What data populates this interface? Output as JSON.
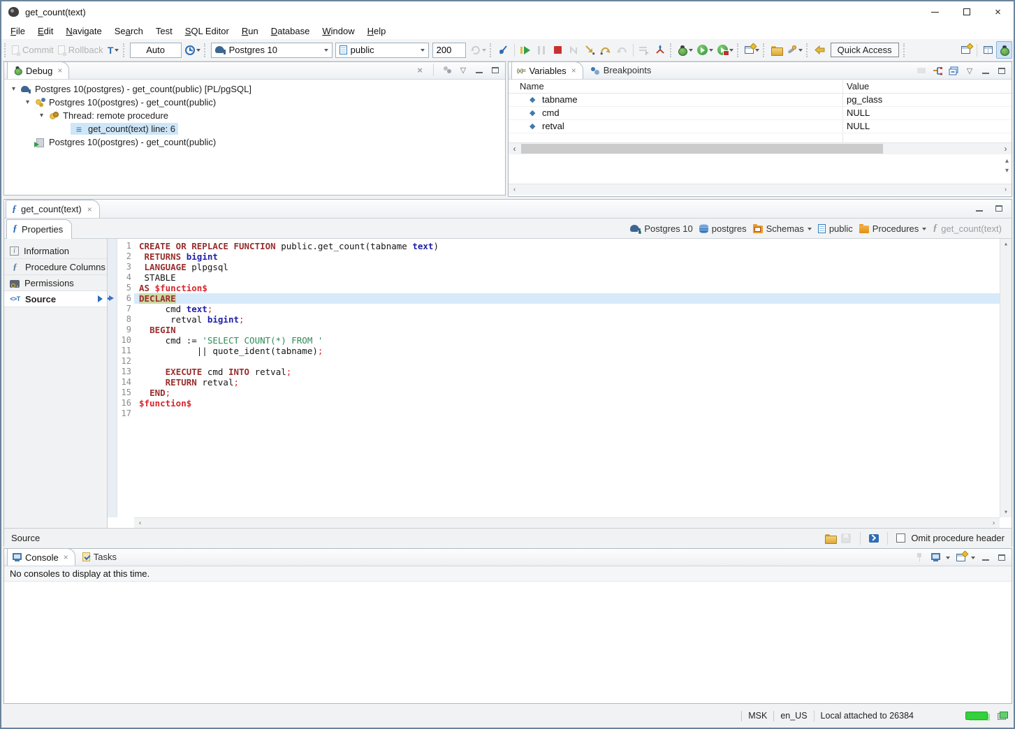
{
  "window": {
    "title": "get_count(text)"
  },
  "icons": {
    "close": "×",
    "caret_down": "▾",
    "view_menu": "▽",
    "scroll_up": "▴",
    "scroll_down": "▾",
    "scroll_left": "‹",
    "scroll_right": "›",
    "diamond": "◆",
    "frame": "≡",
    "function": "ƒ",
    "info": "i",
    "variables_tab": "(x)=",
    "transaction": "T",
    "source_tab": "<>T"
  },
  "colors": {
    "kw": "#992e2e",
    "ty": "#1f1fa8",
    "st": "#2e8b57",
    "dl": "#d8262c",
    "selbg": "#d7eafa",
    "curword": "#ccd9a4",
    "accent": "#2d6db5",
    "green": "#35d03c"
  },
  "menu": {
    "items": [
      {
        "label": "File",
        "mnemonic": "F"
      },
      {
        "label": "Edit",
        "mnemonic": "E"
      },
      {
        "label": "Navigate",
        "mnemonic": "N"
      },
      {
        "label": "Search",
        "mnemonic": "a"
      },
      {
        "label": "Test",
        "mnemonic": ""
      },
      {
        "label": "SQL Editor",
        "mnemonic": "S"
      },
      {
        "label": "Run",
        "mnemonic": "R"
      },
      {
        "label": "Database",
        "mnemonic": "D"
      },
      {
        "label": "Window",
        "mnemonic": "W"
      },
      {
        "label": "Help",
        "mnemonic": "H"
      }
    ]
  },
  "toolbar": {
    "commit": "Commit",
    "rollback": "Rollback",
    "auto": "Auto",
    "connection": "Postgres 10",
    "schema": "public",
    "fetch_size": "200",
    "quick_access": "Quick Access"
  },
  "debug_panel": {
    "tab_label": "Debug",
    "tree": [
      {
        "indent": 0,
        "caret": true,
        "icon": "postgres-session",
        "label": "Postgres 10(postgres) - get_count(public) [PL/pgSQL]",
        "selected": false
      },
      {
        "indent": 1,
        "caret": true,
        "icon": "process",
        "label": "Postgres 10(postgres) - get_count(public)",
        "selected": false
      },
      {
        "indent": 2,
        "caret": true,
        "icon": "thread",
        "label": "Thread: remote procedure",
        "selected": false
      },
      {
        "indent": 3,
        "caret": false,
        "icon": "stack-frame",
        "label": "get_count(text) line: 6",
        "selected": true
      },
      {
        "indent": 1,
        "caret": false,
        "icon": "process-terminated",
        "label": "Postgres 10(postgres) - get_count(public)",
        "selected": false
      }
    ]
  },
  "variables_panel": {
    "tabs": [
      "Variables",
      "Breakpoints"
    ],
    "columns": [
      "Name",
      "Value"
    ],
    "rows": [
      {
        "name": "tabname",
        "value": "pg_class"
      },
      {
        "name": "cmd",
        "value": "NULL"
      },
      {
        "name": "retval",
        "value": "NULL"
      }
    ]
  },
  "editor": {
    "tab_label": "get_count(text)",
    "properties_tab": "Properties",
    "breadcrumb": [
      {
        "label": "Postgres 10",
        "icon": "conn",
        "caret": false,
        "dim": false
      },
      {
        "label": "postgres",
        "icon": "database",
        "caret": false,
        "dim": false
      },
      {
        "label": "Schemas",
        "icon": "schemas",
        "caret": true,
        "dim": false
      },
      {
        "label": "public",
        "icon": "schema",
        "caret": false,
        "dim": false
      },
      {
        "label": "Procedures",
        "icon": "procfolder",
        "caret": true,
        "dim": false
      },
      {
        "label": "get_count(text)",
        "icon": "function",
        "caret": false,
        "dim": true
      }
    ],
    "sidebar": [
      {
        "label": "Information",
        "icon": "info",
        "selected": false
      },
      {
        "label": "Procedure Columns",
        "icon": "func",
        "selected": false
      },
      {
        "label": "Permissions",
        "icon": "perm",
        "selected": false
      },
      {
        "label": "Source",
        "icon": "source",
        "selected": true
      }
    ],
    "code": {
      "lines": [
        {
          "n": 1,
          "current": false,
          "segs": [
            [
              "kw",
              "CREATE OR REPLACE FUNCTION"
            ],
            [
              "pl",
              " public.get_count(tabname "
            ],
            [
              "ty",
              "text"
            ],
            [
              "pl",
              ")"
            ]
          ]
        },
        {
          "n": 2,
          "current": false,
          "segs": [
            [
              "pl",
              " "
            ],
            [
              "kw",
              "RETURNS"
            ],
            [
              "pl",
              " "
            ],
            [
              "ty",
              "bigint"
            ]
          ]
        },
        {
          "n": 3,
          "current": false,
          "segs": [
            [
              "pl",
              " "
            ],
            [
              "kw",
              "LANGUAGE"
            ],
            [
              "pl",
              " plpgsql"
            ]
          ]
        },
        {
          "n": 4,
          "current": false,
          "segs": [
            [
              "pl",
              " STABLE"
            ]
          ]
        },
        {
          "n": 5,
          "current": false,
          "segs": [
            [
              "kw",
              "AS"
            ],
            [
              "pl",
              " "
            ],
            [
              "dl",
              "$function$"
            ]
          ]
        },
        {
          "n": 6,
          "current": true,
          "segs": [
            [
              "kw",
              "DECLARE"
            ]
          ]
        },
        {
          "n": 7,
          "current": false,
          "segs": [
            [
              "pl",
              "     cmd "
            ],
            [
              "ty",
              "text"
            ],
            [
              "sc",
              ";"
            ]
          ]
        },
        {
          "n": 8,
          "current": false,
          "segs": [
            [
              "pl",
              "      retval "
            ],
            [
              "ty",
              "bigint"
            ],
            [
              "sc",
              ";"
            ]
          ]
        },
        {
          "n": 9,
          "current": false,
          "segs": [
            [
              "pl",
              "  "
            ],
            [
              "kw",
              "BEGIN"
            ]
          ]
        },
        {
          "n": 10,
          "current": false,
          "segs": [
            [
              "pl",
              "     cmd := "
            ],
            [
              "st",
              "'SELECT COUNT(*) FROM '"
            ]
          ]
        },
        {
          "n": 11,
          "current": false,
          "segs": [
            [
              "pl",
              "           || quote_ident(tabname)"
            ],
            [
              "sc",
              ";"
            ]
          ]
        },
        {
          "n": 12,
          "current": false,
          "segs": []
        },
        {
          "n": 13,
          "current": false,
          "segs": [
            [
              "pl",
              "     "
            ],
            [
              "kw",
              "EXECUTE"
            ],
            [
              "pl",
              " cmd "
            ],
            [
              "kw",
              "INTO"
            ],
            [
              "pl",
              " retval"
            ],
            [
              "sc",
              ";"
            ]
          ]
        },
        {
          "n": 14,
          "current": false,
          "segs": [
            [
              "pl",
              "     "
            ],
            [
              "kw",
              "RETURN"
            ],
            [
              "pl",
              " retval"
            ],
            [
              "sc",
              ";"
            ]
          ]
        },
        {
          "n": 15,
          "current": false,
          "segs": [
            [
              "pl",
              "  "
            ],
            [
              "kw",
              "END"
            ],
            [
              "sc",
              ";"
            ]
          ]
        },
        {
          "n": 16,
          "current": false,
          "segs": [
            [
              "dl",
              "$function$"
            ]
          ]
        },
        {
          "n": 17,
          "current": false,
          "segs": []
        }
      ]
    },
    "bottom_label": "Source",
    "omit_label": "Omit procedure header"
  },
  "console_panel": {
    "tabs": [
      "Console",
      "Tasks"
    ],
    "message": "No consoles to display at this time."
  },
  "status_bar": {
    "timezone": "MSK",
    "locale": "en_US",
    "message": "Local attached to 26384"
  }
}
